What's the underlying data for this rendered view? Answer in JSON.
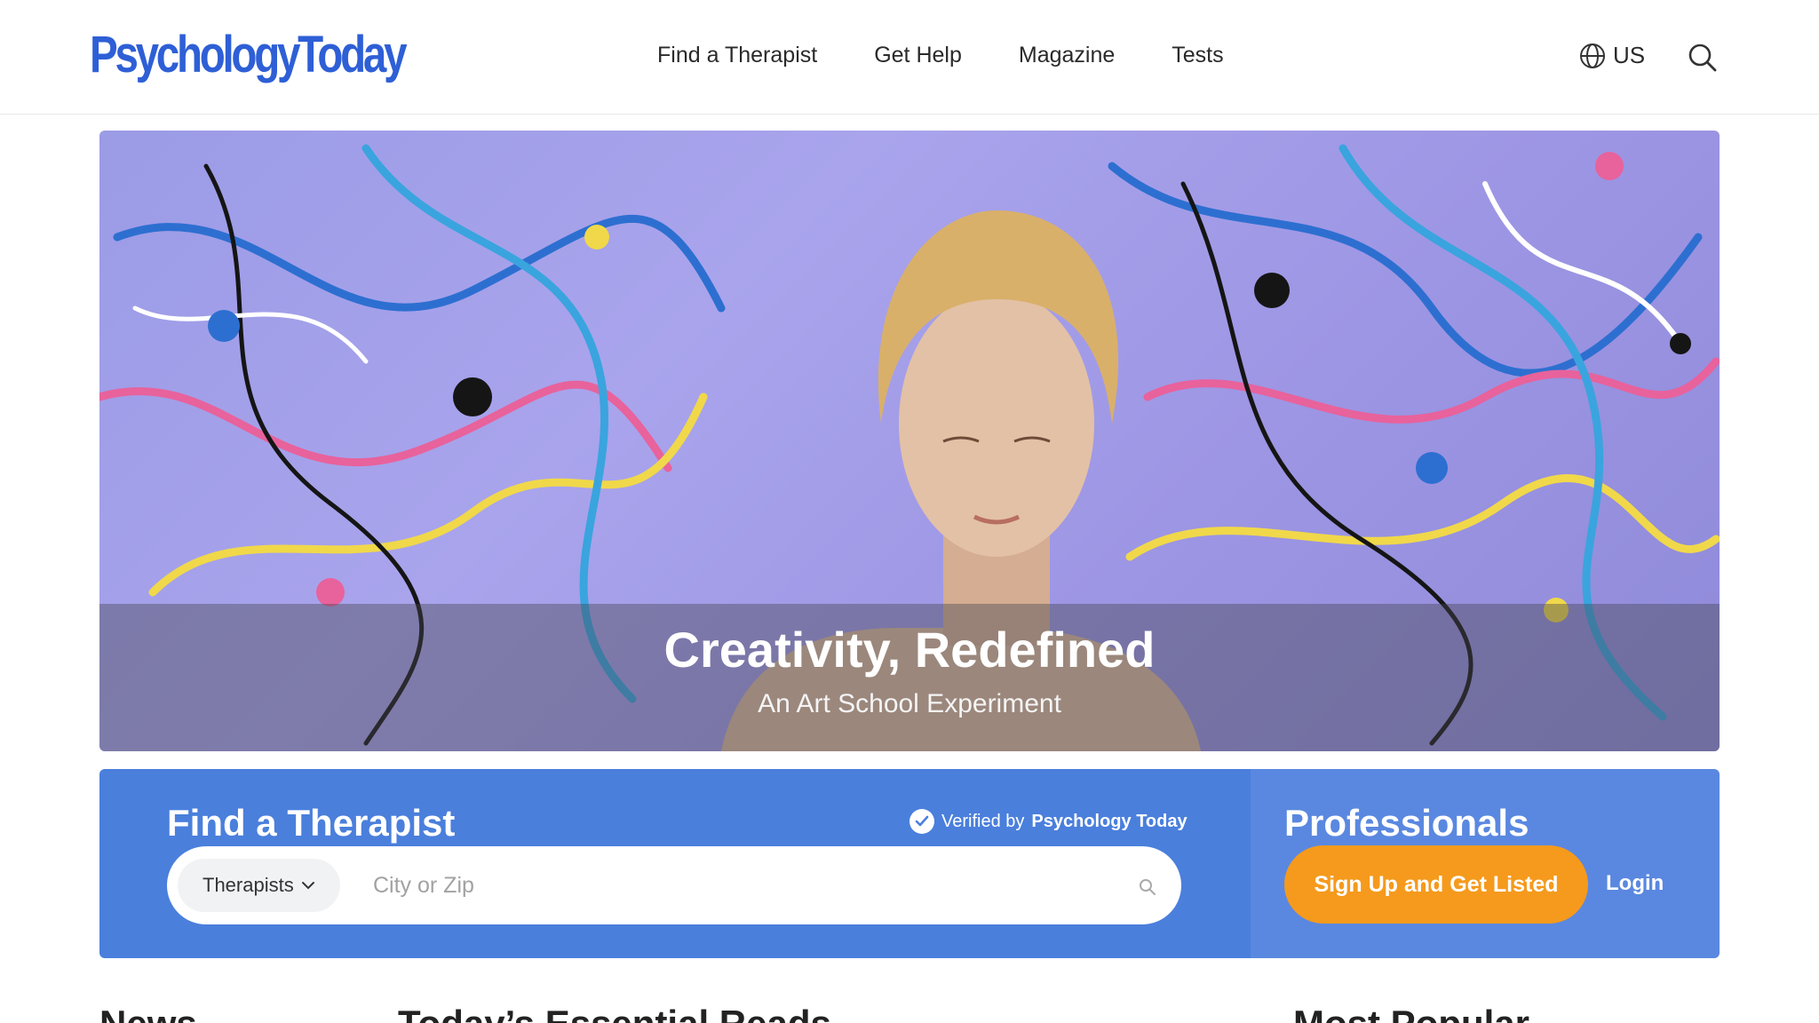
{
  "header": {
    "logo_text": "PsychologyToday",
    "nav": [
      "Find a Therapist",
      "Get Help",
      "Magazine",
      "Tests"
    ],
    "region_label": "US",
    "region_icon": "globe-icon",
    "search_icon": "search-icon"
  },
  "hero": {
    "title": "Creativity, Redefined",
    "subtitle": "An Art School Experiment"
  },
  "find_therapist": {
    "title": "Find a Therapist",
    "verified_prefix": "Verified by",
    "verified_brand": "Psychology Today",
    "select_value": "Therapists",
    "input_placeholder": "City or Zip"
  },
  "professionals": {
    "title": "Professionals",
    "signup_label": "Sign Up and Get Listed",
    "login_label": "Login"
  },
  "sections": [
    "News",
    "Today’s Essential Reads",
    "Most Popular"
  ],
  "colors": {
    "brand_blue": "#2e5fd6",
    "panel_blue": "#4a7fdc",
    "panel_blue_light": "#5a88e0",
    "cta_orange": "#f59a1c"
  }
}
